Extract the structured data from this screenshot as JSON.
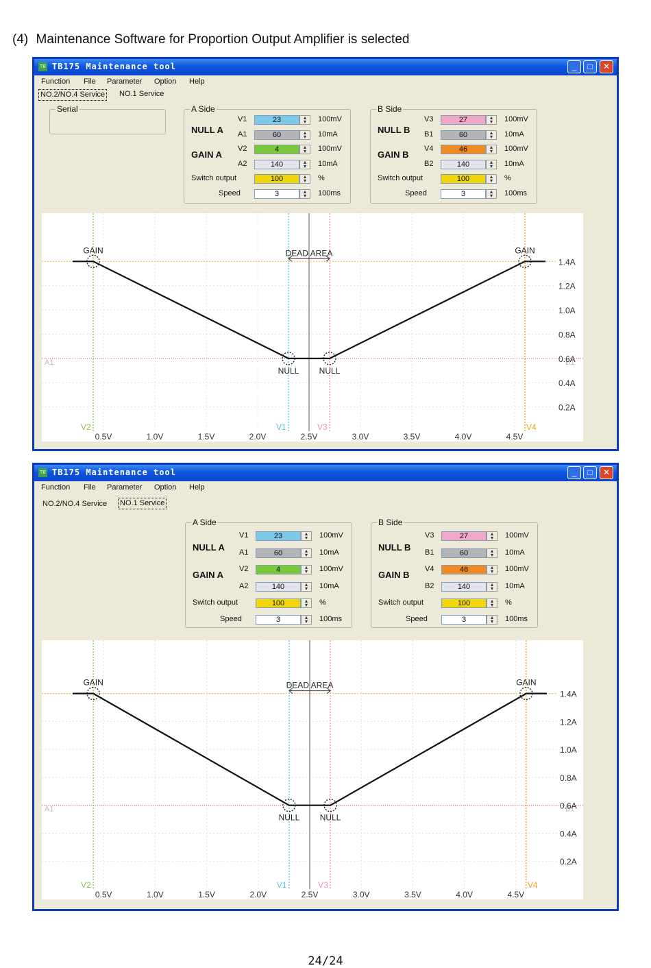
{
  "doc": {
    "heading_num": "(4)",
    "heading_text": "Maintenance Software for Proportion Output Amplifier is selected",
    "page_number": "24/24"
  },
  "window": {
    "title": "TB175 Maintenance tool",
    "icon_text": "TB",
    "menu": [
      "Function",
      "File",
      "Parameter",
      "Option",
      "Help"
    ],
    "tabs": [
      "NO.2/NO.4 Service",
      "NO.1 Service"
    ],
    "serial_label": "Serial",
    "a_side": {
      "title": "A Side",
      "null_label": "NULL A",
      "gain_label": "GAIN A",
      "switch_label": "Switch output",
      "speed_label": "Speed",
      "rows": [
        {
          "name": "V1",
          "value": "23",
          "unit": "100mV",
          "color": "#7EC8E8"
        },
        {
          "name": "A1",
          "value": "60",
          "unit": "10mA",
          "color": "#B4B4B4"
        },
        {
          "name": "V2",
          "value": "4",
          "unit": "100mV",
          "color": "#7CC83C"
        },
        {
          "name": "A2",
          "value": "140",
          "unit": "10mA",
          "color": "#E4E4EE"
        }
      ],
      "switch_value": "100",
      "switch_unit": "%",
      "switch_color": "#F2D60C",
      "speed_value": "3",
      "speed_unit": "100ms"
    },
    "b_side": {
      "title": "B Side",
      "null_label": "NULL B",
      "gain_label": "GAIN B",
      "switch_label": "Switch output",
      "speed_label": "Speed",
      "rows": [
        {
          "name": "V3",
          "value": "27",
          "unit": "100mV",
          "color": "#F0A8C8"
        },
        {
          "name": "B1",
          "value": "60",
          "unit": "10mA",
          "color": "#B4B4B4"
        },
        {
          "name": "V4",
          "value": "46",
          "unit": "100mV",
          "color": "#F08A24"
        },
        {
          "name": "B2",
          "value": "140",
          "unit": "10mA",
          "color": "#E4E4EE"
        }
      ],
      "switch_value": "100",
      "switch_unit": "%",
      "switch_color": "#F2D60C",
      "speed_value": "3",
      "speed_unit": "100ms"
    }
  },
  "chart_data": {
    "type": "line",
    "x_ticks": [
      "0.5V",
      "1.0V",
      "1.5V",
      "2.0V",
      "2.5V",
      "3.0V",
      "3.5V",
      "4.0V",
      "4.5V"
    ],
    "y_ticks": [
      "1.4A",
      "1.2A",
      "1.0A",
      "0.8A",
      "0.6A",
      "0.4A",
      "0.2A"
    ],
    "xlim": [
      0.1,
      4.9
    ],
    "ylim": [
      0.0,
      1.56
    ],
    "series": [
      {
        "x": [
          0.2,
          0.4,
          2.3,
          2.7,
          4.6,
          4.8
        ],
        "y": [
          1.4,
          1.4,
          0.6,
          0.6,
          1.4,
          1.4
        ]
      }
    ],
    "markers": [
      {
        "label": "GAIN",
        "x": 0.4,
        "y": 1.4
      },
      {
        "label": "GAIN",
        "x": 4.6,
        "y": 1.4
      },
      {
        "label": "NULL",
        "x": 2.3,
        "y": 0.6
      },
      {
        "label": "NULL",
        "x": 2.7,
        "y": 0.6
      }
    ],
    "vlines": [
      {
        "label": "V2",
        "x": 0.4,
        "color": "#8BC34A"
      },
      {
        "label": "V1",
        "x": 2.3,
        "color": "#5BC0EB"
      },
      {
        "label": "V3",
        "x": 2.7,
        "color": "#F48FB1"
      },
      {
        "label": "V4",
        "x": 4.6,
        "color": "#F39C12"
      }
    ],
    "hlines": [
      {
        "label": "A1",
        "side": "left",
        "y": 0.6
      },
      {
        "label": "B1",
        "side": "right",
        "y": 0.6
      }
    ],
    "gain_line_y": 1.4,
    "dead_area_label": "DEAD AREA",
    "grid": true
  }
}
